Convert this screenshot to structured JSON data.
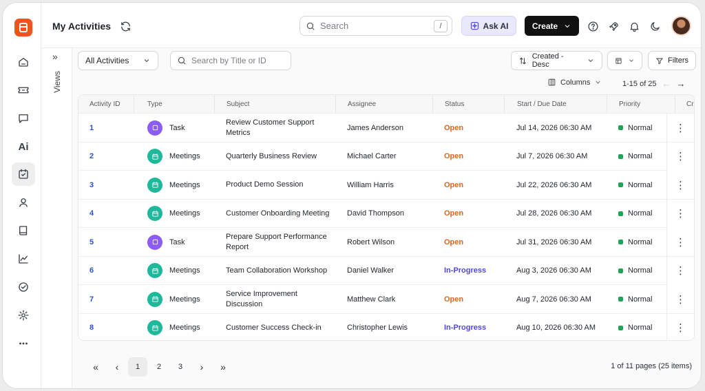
{
  "header": {
    "title": "My Activities",
    "search_placeholder": "Search",
    "search_shortcut": "/",
    "ask_ai": "Ask AI",
    "create": "Create"
  },
  "views_label": "Views",
  "filters": {
    "view_select": "All Activities",
    "search_placeholder": "Search by Title or ID",
    "sort": "Created - Desc",
    "filters_label": "Filters"
  },
  "columns_label": "Columns",
  "pager_top": "1-15 of 25",
  "table": {
    "headers": [
      "Activity ID",
      "Type",
      "Subject",
      "Assignee",
      "Status",
      "Start / Due Date",
      "Priority",
      "Cre"
    ],
    "rows": [
      {
        "id": "1",
        "type": "Task",
        "type_kind": "task",
        "subject": "Review Customer Support Metrics",
        "assignee": "James Anderson",
        "status": "Open",
        "date": "Jul 14, 2026 06:30 AM",
        "priority": "Normal"
      },
      {
        "id": "2",
        "type": "Meetings",
        "type_kind": "meet",
        "subject": "Quarterly Business Review",
        "assignee": "Michael Carter",
        "status": "Open",
        "date": "Jul 7, 2026 06:30 AM",
        "priority": "Normal"
      },
      {
        "id": "3",
        "type": "Meetings",
        "type_kind": "meet",
        "subject": "Product Demo Session",
        "assignee": "William Harris",
        "status": "Open",
        "date": "Jul 22, 2026 06:30 AM",
        "priority": "Normal"
      },
      {
        "id": "4",
        "type": "Meetings",
        "type_kind": "meet",
        "subject": "Customer Onboarding Meeting",
        "assignee": "David Thompson",
        "status": "Open",
        "date": "Jul 28, 2026 06:30 AM",
        "priority": "Normal"
      },
      {
        "id": "5",
        "type": "Task",
        "type_kind": "task",
        "subject": "Prepare Support Performance Report",
        "assignee": "Robert Wilson",
        "status": "Open",
        "date": "Jul 31, 2026 06:30 AM",
        "priority": "Normal"
      },
      {
        "id": "6",
        "type": "Meetings",
        "type_kind": "meet",
        "subject": "Team Collaboration Workshop",
        "assignee": "Daniel Walker",
        "status": "In-Progress",
        "date": "Aug 3, 2026 06:30 AM",
        "priority": "Normal"
      },
      {
        "id": "7",
        "type": "Meetings",
        "type_kind": "meet",
        "subject": "Service Improvement Discussion",
        "assignee": "Matthew Clark",
        "status": "Open",
        "date": "Aug 7, 2026 06:30 AM",
        "priority": "Normal"
      },
      {
        "id": "8",
        "type": "Meetings",
        "type_kind": "meet",
        "subject": "Customer Success Check-in",
        "assignee": "Christopher Lewis",
        "status": "In-Progress",
        "date": "Aug 10, 2026 06:30 AM",
        "priority": "Normal"
      }
    ]
  },
  "pagination": {
    "pages": [
      "1",
      "2",
      "3"
    ],
    "current": "1",
    "info": "1 of 11 pages (25 items)"
  },
  "colors": {
    "brand": "#f0531f",
    "open": "#e0651b",
    "in_progress": "#4f46e5",
    "priority_normal": "#22a35a",
    "task_icon": "#8b5cf6",
    "meeting_icon": "#1fb89a"
  },
  "sidebar_icons": [
    "home-icon",
    "ticket-icon",
    "chat-icon",
    "ai-icon",
    "calendar-check-icon",
    "user-icon",
    "book-icon",
    "chart-icon",
    "check-circle-icon",
    "settings-icon",
    "more-icon"
  ]
}
